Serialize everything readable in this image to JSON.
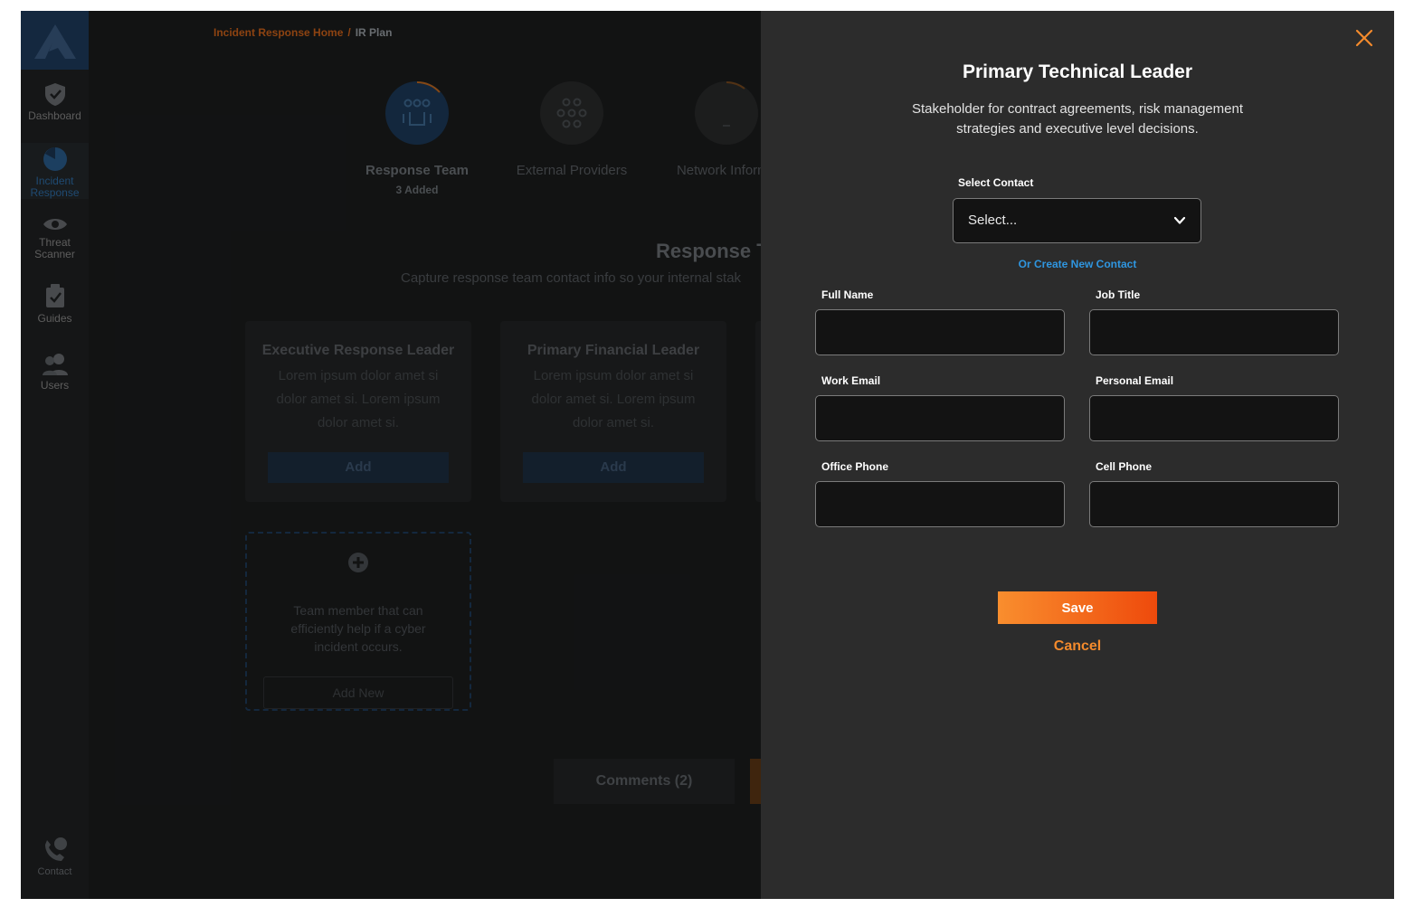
{
  "sidebar": {
    "items": [
      {
        "label": "Dashboard",
        "icon": "shield-check-icon"
      },
      {
        "label_line1": "Incident",
        "label_line2": "Response",
        "icon": "pie-chart-icon"
      },
      {
        "label_line1": "Threat",
        "label_line2": "Scanner",
        "icon": "eye-icon"
      },
      {
        "label": "Guides",
        "icon": "clipboard-check-icon"
      },
      {
        "label": "Users",
        "icon": "users-icon"
      }
    ],
    "contact_label": "Contact"
  },
  "breadcrumb": {
    "home": "Incident Response Home",
    "separator": "/",
    "current": "IR Plan"
  },
  "steps": [
    {
      "label": "Response Team",
      "sub": "3 Added"
    },
    {
      "label": "External Providers",
      "sub": ""
    },
    {
      "label": "Network Informa",
      "sub": ""
    }
  ],
  "section": {
    "title": "Response T",
    "description": "Capture response team contact info so your internal stak"
  },
  "cards": [
    {
      "title": "Executive Response Leader",
      "desc": "Lorem ipsum dolor amet si dolor amet si. Lorem ipsum dolor amet si.",
      "button": "Add"
    },
    {
      "title": "Primary Financial Leader",
      "desc": "Lorem ipsum dolor amet si dolor amet si. Lorem ipsum dolor amet si.",
      "button": "Add"
    }
  ],
  "add_new": {
    "desc": "Team member that can efficiently help if a cyber incident occurs.",
    "button": "Add New"
  },
  "comments": {
    "label": "Comments (2)"
  },
  "drawer": {
    "title": "Primary Technical Leader",
    "description": "Stakeholder for contract agreements, risk management strategies and executive level decisions.",
    "select_label": "Select Contact",
    "select_value": "Select...",
    "create_link": "Or Create New Contact",
    "fields": {
      "full_name": {
        "label": "Full Name",
        "value": ""
      },
      "job_title": {
        "label": "Job Title",
        "value": ""
      },
      "work_email": {
        "label": "Work Email",
        "value": ""
      },
      "personal_email": {
        "label": "Personal Email",
        "value": ""
      },
      "office_phone": {
        "label": "Office Phone",
        "value": ""
      },
      "cell_phone": {
        "label": "Cell Phone",
        "value": ""
      }
    },
    "save_label": "Save",
    "cancel_label": "Cancel"
  },
  "colors": {
    "accent_orange": "#f38a2c",
    "link_blue": "#2f96e0",
    "drawer_bg": "#2c2c2c",
    "input_bg": "#131313"
  }
}
